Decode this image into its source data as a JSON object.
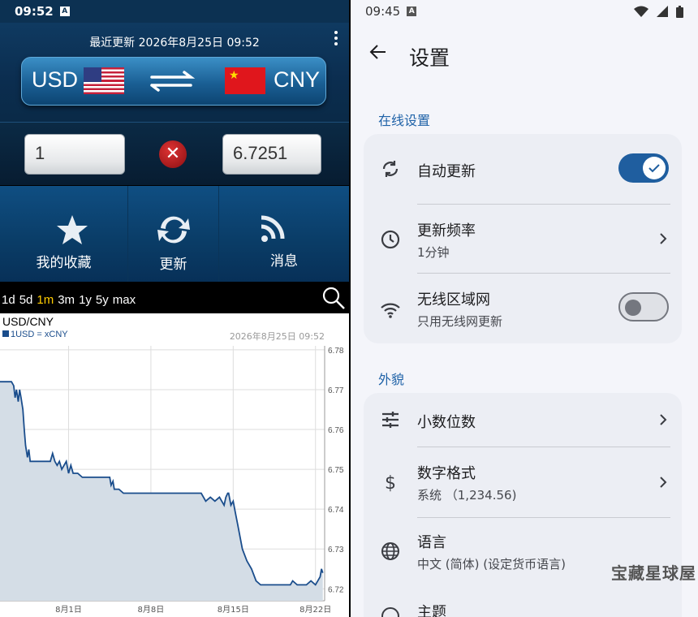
{
  "left": {
    "status_time": "09:52",
    "updated": "最近更新 2026年8月25日 09:52",
    "from_currency": "USD",
    "to_currency": "CNY",
    "amount_from": "1",
    "amount_to": "6.7251",
    "actions": [
      {
        "label": "我的收藏",
        "icon": "star-icon"
      },
      {
        "label": "更新",
        "icon": "refresh-icon"
      },
      {
        "label": "消息",
        "icon": "rss-icon"
      }
    ],
    "ranges": [
      "1d",
      "5d",
      "1m",
      "3m",
      "1y",
      "5y",
      "max"
    ],
    "selected_range": "1m"
  },
  "chart_data": {
    "type": "area",
    "title": "USD/CNY",
    "legend": "1USD = xCNY",
    "timestamp": "2026年8月25日 09:52",
    "x_ticks": [
      "8月1日",
      "8月8日",
      "8月15日",
      "8月22日"
    ],
    "y_ticks": [
      6.72,
      6.73,
      6.74,
      6.75,
      6.76,
      6.77,
      6.78
    ],
    "ylim": [
      6.717,
      6.781
    ],
    "x": [
      0,
      2.5,
      3,
      3.3,
      3.6,
      4,
      4.3,
      4.6,
      5,
      5.3,
      5.6,
      6,
      6.3,
      6.6,
      7,
      7.5,
      8,
      8.5,
      9,
      9.5,
      10,
      10.5,
      11,
      11.5,
      12,
      12.5,
      13,
      13.5,
      14,
      14.5,
      15,
      15.5,
      16,
      17,
      18,
      19,
      20,
      21,
      22,
      23,
      24,
      24.3,
      24.7,
      25,
      26,
      27,
      28,
      29,
      30,
      31,
      32,
      33,
      34,
      35,
      36,
      37,
      38,
      39,
      40,
      41,
      42,
      43,
      44,
      45,
      46,
      47,
      48,
      49,
      49.4,
      49.8,
      50,
      50.5,
      51,
      51.5,
      52,
      53,
      54,
      55,
      56,
      57,
      58,
      59,
      60,
      60.5,
      61,
      61.5,
      62,
      62.5,
      63,
      63.5,
      64,
      65,
      66,
      67,
      68,
      69,
      70,
      70.3,
      70.6
    ],
    "y": [
      6.772,
      6.772,
      6.771,
      6.768,
      6.77,
      6.767,
      6.77,
      6.768,
      6.765,
      6.76,
      6.756,
      6.753,
      6.755,
      6.752,
      6.752,
      6.752,
      6.752,
      6.752,
      6.752,
      6.752,
      6.752,
      6.752,
      6.752,
      6.754,
      6.752,
      6.751,
      6.752,
      6.75,
      6.751,
      6.752,
      6.749,
      6.751,
      6.749,
      6.749,
      6.748,
      6.748,
      6.748,
      6.748,
      6.748,
      6.748,
      6.748,
      6.746,
      6.747,
      6.745,
      6.745,
      6.744,
      6.744,
      6.744,
      6.744,
      6.744,
      6.744,
      6.744,
      6.744,
      6.744,
      6.744,
      6.744,
      6.744,
      6.744,
      6.744,
      6.744,
      6.744,
      6.744,
      6.744,
      6.742,
      6.743,
      6.742,
      6.743,
      6.741,
      6.743,
      6.744,
      6.744,
      6.741,
      6.742,
      6.739,
      6.736,
      6.73,
      6.727,
      6.725,
      6.722,
      6.721,
      6.721,
      6.721,
      6.721,
      6.721,
      6.721,
      6.721,
      6.721,
      6.721,
      6.721,
      6.721,
      6.722,
      6.721,
      6.721,
      6.721,
      6.722,
      6.721,
      6.723,
      6.725,
      6.724
    ],
    "x_tick_positions": [
      15,
      33,
      51,
      69
    ],
    "x_range": [
      0,
      71
    ],
    "line_color": "#1a4d8c",
    "fill_color": "#d4dde6"
  },
  "right": {
    "status_time": "09:45",
    "title": "设置",
    "section_online": "在线设置",
    "auto_update": "自动更新",
    "auto_update_on": true,
    "freq_title": "更新频率",
    "freq_value": "1分钟",
    "wifi_title": "无线区域网",
    "wifi_sub": "只用无线网更新",
    "wifi_on": false,
    "section_look": "外貌",
    "decimals": "小数位数",
    "number_format": "数字格式",
    "number_format_value": "系统 （1,234.56)",
    "language": "语言",
    "language_value": "中文 (简体) (设定货币语言)",
    "theme": "主题",
    "watermark": "宝藏星球屋"
  }
}
